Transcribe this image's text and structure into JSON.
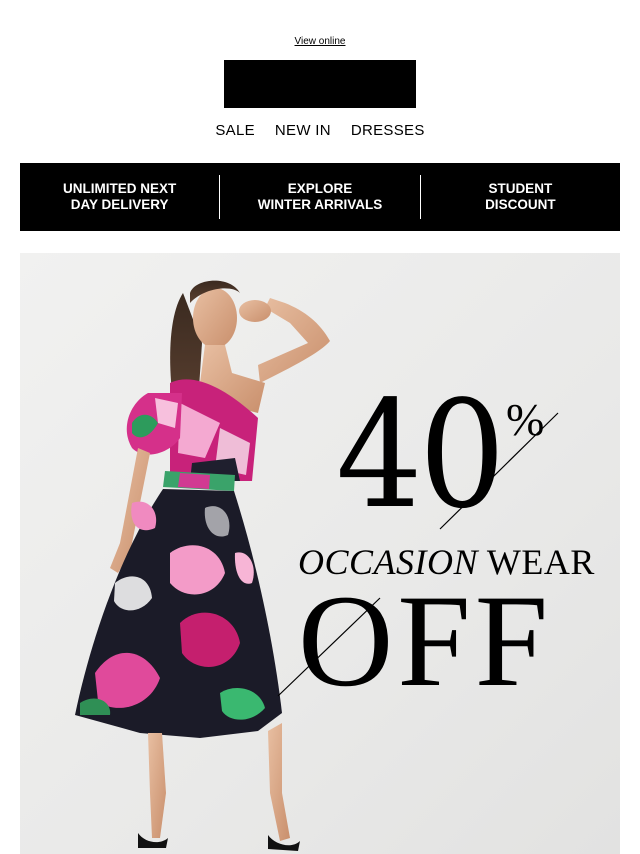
{
  "header": {
    "view_online": "View online"
  },
  "nav": {
    "items": [
      "SALE",
      "NEW IN",
      "DRESSES"
    ]
  },
  "promo_bar": {
    "items": [
      "UNLIMITED NEXT\nDAY DELIVERY",
      "EXPLORE\nWINTER ARRIVALS",
      "STUDENT\nDISCOUNT"
    ]
  },
  "hero": {
    "number": "40",
    "percent": "%",
    "occasion_italic": "OCCASION",
    "occasion_rest": " WEAR",
    "off": "OFF"
  },
  "colors": {
    "black": "#000000",
    "background": "#ffffff",
    "hero_bg": "#ececeb"
  }
}
